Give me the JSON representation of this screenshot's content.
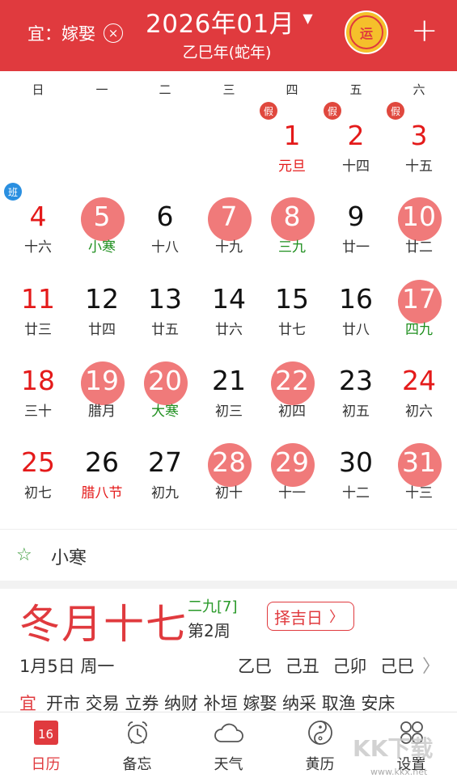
{
  "header": {
    "filter_label": "宜：嫁娶",
    "filter_clear": "×",
    "month_title": "2026年01月",
    "caret": "▼",
    "lunar_year": "乙巳年(蛇年)",
    "yun_label": "运",
    "add_label": "+",
    "background": "#e03a3e"
  },
  "weekdays": [
    "日",
    "一",
    "二",
    "三",
    "四",
    "五",
    "六"
  ],
  "calendar": {
    "highlight_color": "#f07a7a",
    "holiday_badge": "假",
    "work_badge": "班",
    "days": [
      {
        "day": "1",
        "sub": "元旦",
        "col": 4,
        "row": 0,
        "red": true,
        "sub_style": "red",
        "badge": "holiday"
      },
      {
        "day": "2",
        "sub": "十四",
        "col": 5,
        "row": 0,
        "red": true,
        "badge": "holiday"
      },
      {
        "day": "3",
        "sub": "十五",
        "col": 6,
        "row": 0,
        "red": true,
        "badge": "holiday"
      },
      {
        "day": "4",
        "sub": "十六",
        "col": 0,
        "row": 1,
        "red": true,
        "badge": "work"
      },
      {
        "day": "5",
        "sub": "小寒",
        "col": 1,
        "row": 1,
        "hl": true,
        "sub_style": "green"
      },
      {
        "day": "6",
        "sub": "十八",
        "col": 2,
        "row": 1
      },
      {
        "day": "7",
        "sub": "十九",
        "col": 3,
        "row": 1,
        "hl": true
      },
      {
        "day": "8",
        "sub": "三九",
        "col": 4,
        "row": 1,
        "hl": true,
        "sub_style": "green"
      },
      {
        "day": "9",
        "sub": "廿一",
        "col": 5,
        "row": 1
      },
      {
        "day": "10",
        "sub": "廿二",
        "col": 6,
        "row": 1,
        "hl": true,
        "red": true
      },
      {
        "day": "11",
        "sub": "廿三",
        "col": 0,
        "row": 2,
        "red": true
      },
      {
        "day": "12",
        "sub": "廿四",
        "col": 1,
        "row": 2
      },
      {
        "day": "13",
        "sub": "廿五",
        "col": 2,
        "row": 2
      },
      {
        "day": "14",
        "sub": "廿六",
        "col": 3,
        "row": 2
      },
      {
        "day": "15",
        "sub": "廿七",
        "col": 4,
        "row": 2
      },
      {
        "day": "16",
        "sub": "廿八",
        "col": 5,
        "row": 2
      },
      {
        "day": "17",
        "sub": "四九",
        "col": 6,
        "row": 2,
        "hl": true,
        "red": true,
        "sub_style": "green"
      },
      {
        "day": "18",
        "sub": "三十",
        "col": 0,
        "row": 3,
        "red": true
      },
      {
        "day": "19",
        "sub": "腊月",
        "col": 1,
        "row": 3,
        "hl": true
      },
      {
        "day": "20",
        "sub": "大寒",
        "col": 2,
        "row": 3,
        "hl": true,
        "sub_style": "green"
      },
      {
        "day": "21",
        "sub": "初三",
        "col": 3,
        "row": 3
      },
      {
        "day": "22",
        "sub": "初四",
        "col": 4,
        "row": 3,
        "hl": true
      },
      {
        "day": "23",
        "sub": "初五",
        "col": 5,
        "row": 3
      },
      {
        "day": "24",
        "sub": "初六",
        "col": 6,
        "row": 3,
        "red": true
      },
      {
        "day": "25",
        "sub": "初七",
        "col": 0,
        "row": 4,
        "red": true
      },
      {
        "day": "26",
        "sub": "腊八节",
        "col": 1,
        "row": 4,
        "sub_style": "red"
      },
      {
        "day": "27",
        "sub": "初九",
        "col": 2,
        "row": 4
      },
      {
        "day": "28",
        "sub": "初十",
        "col": 3,
        "row": 4,
        "hl": true
      },
      {
        "day": "29",
        "sub": "十一",
        "col": 4,
        "row": 4,
        "hl": true
      },
      {
        "day": "30",
        "sub": "十二",
        "col": 5,
        "row": 4
      },
      {
        "day": "31",
        "sub": "十三",
        "col": 6,
        "row": 4,
        "hl": true,
        "red": true
      }
    ]
  },
  "term_row": {
    "star": "☆",
    "label": "小寒"
  },
  "detail": {
    "lunar_date": "冬月十七",
    "jiu": "二九[7]",
    "week": "第2周",
    "zeji_label": "择吉日",
    "zeji_chevron": "〉",
    "solar_date": "1月5日 周一",
    "ganzhi": "乙巳 己丑 己卯 己巳",
    "ganzhi_chevron": "〉",
    "yi_label": "宜",
    "yi_items": "开市 交易 立券 纳财 补垣 嫁娶 纳采 取渔 安床"
  },
  "tabbar": {
    "calendar_icon_day": "16",
    "tabs": [
      {
        "label": "日历",
        "icon": "calendar-icon",
        "active": true
      },
      {
        "label": "备忘",
        "icon": "alarm-clock-icon"
      },
      {
        "label": "天气",
        "icon": "cloud-icon"
      },
      {
        "label": "黄历",
        "icon": "yin-yang-icon"
      },
      {
        "label": "设置",
        "icon": "grid-circles-icon"
      }
    ]
  },
  "watermark": {
    "text": "KK下载",
    "url": "www.kkx.net"
  }
}
